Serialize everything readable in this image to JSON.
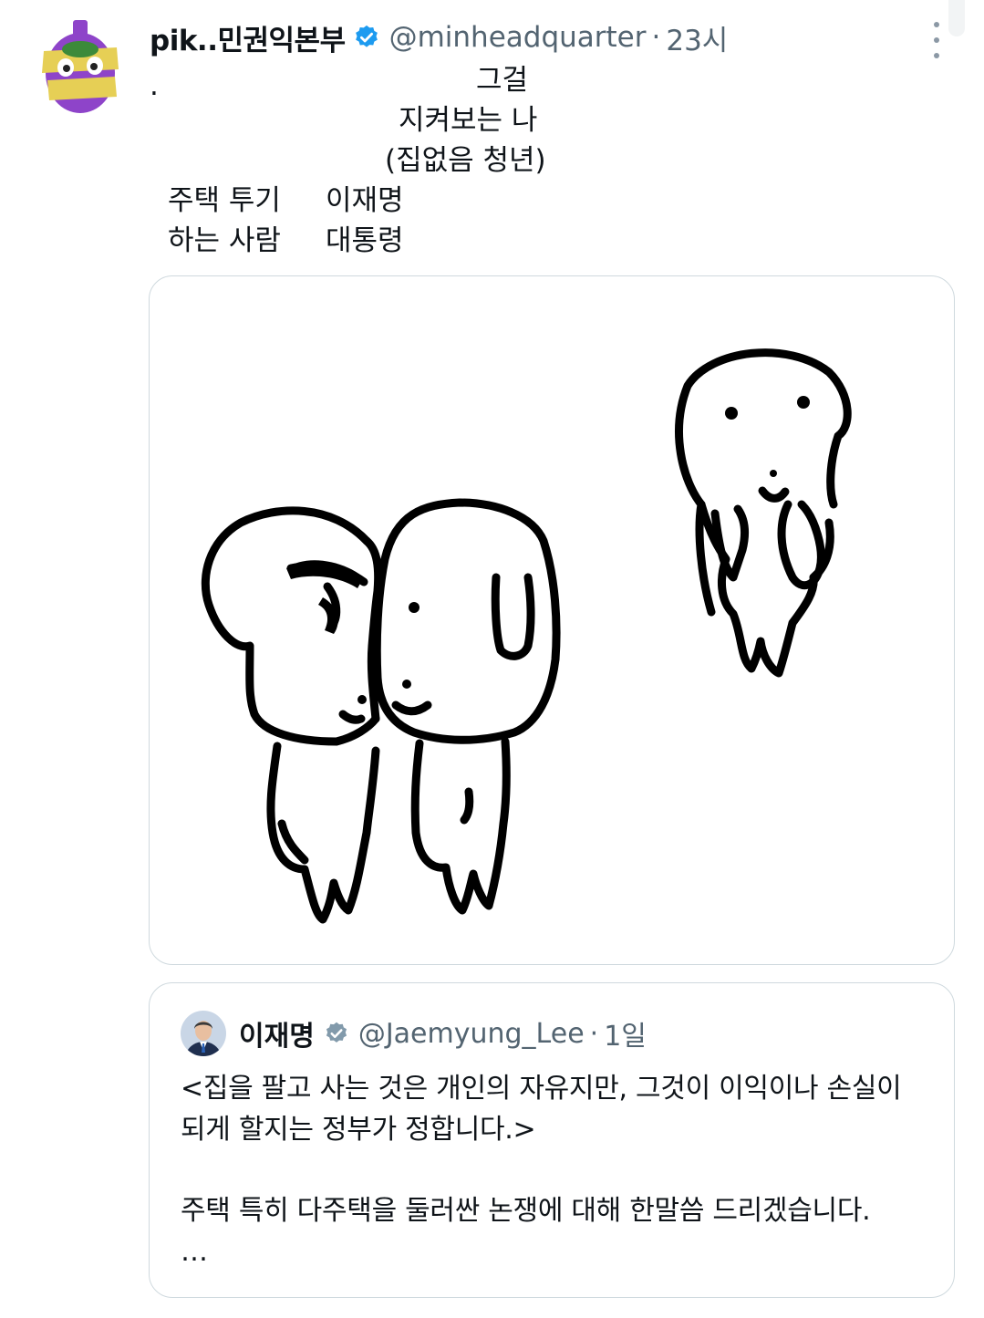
{
  "tweet": {
    "author": {
      "display_name": "pik..민권익본부",
      "handle": "@minheadquarter",
      "verified": true,
      "avatar_icon": "purple-character-avatar"
    },
    "separator": "·",
    "time": "23시",
    "more_icon": "more-vertical-icon",
    "text_lines": [
      ".",
      "그걸",
      "지켜보는 나",
      "(집없음 청년)",
      "주택 투기",
      "이재명",
      "하는 사람",
      "대통령"
    ]
  },
  "media": {
    "image_icon": "doodle-dogs-illustration"
  },
  "quoted_tweet": {
    "author": {
      "display_name": "이재명",
      "handle": "@Jaemyung_Lee",
      "verified": true,
      "badge_color": "#829aab",
      "avatar_icon": "politician-portrait-avatar"
    },
    "separator": "·",
    "time": "1일",
    "text_lines": [
      "<집을 팔고 사는 것은 개인의 자유지만, 그것이 이익이나 손실이",
      "되게 할지는 정부가 정합니다.>",
      "주택 특히 다주택을 둘러싼 논쟁에 대해 한말씀 드리겠습니다.",
      "…"
    ]
  },
  "colors": {
    "verified_blue": "#1d9bf0",
    "muted_text": "#536471",
    "border": "#cfd9de"
  }
}
